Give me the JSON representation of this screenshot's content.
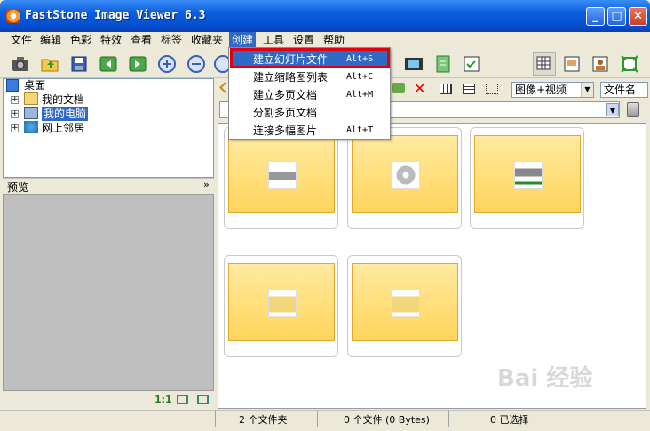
{
  "window": {
    "title": "FastStone Image Viewer 6.3",
    "minimize": "_",
    "maximize": "□",
    "close": "✕"
  },
  "menu": [
    "文件",
    "编辑",
    "色彩",
    "特效",
    "查看",
    "标签",
    "收藏夹",
    "创建",
    "工具",
    "设置",
    "帮助"
  ],
  "dropdown": [
    {
      "label": "建立幻灯片文件",
      "shortcut": "Alt+S"
    },
    {
      "label": "建立缩略图列表",
      "shortcut": "Alt+C"
    },
    {
      "label": "建立多页文档",
      "shortcut": "Alt+M"
    },
    {
      "label": "分割多页文档",
      "shortcut": ""
    },
    {
      "label": "连接多幅图片",
      "shortcut": "Alt+T"
    }
  ],
  "tree": {
    "root": "桌面",
    "items": [
      "我的文档",
      "我的电脑",
      "网上邻居"
    ]
  },
  "preview": {
    "title": "预览",
    "collapse": "»",
    "zoom": "1:1"
  },
  "browser": {
    "filter": "图像+视频",
    "sort": "文件名",
    "thumbnails": [
      "hard-drive",
      "cd-drive",
      "network-drive",
      "folder",
      "folder"
    ]
  },
  "status": {
    "folders": "2 个文件夹",
    "files": "0 个文件 (0 Bytes)",
    "selected": "0 已选择"
  },
  "watermark": "Bai 经验",
  "colors": {
    "titlebar": "#0a5fde",
    "highlight": "#316ac5",
    "callout": "#e00010",
    "thumb": "#ffd45c"
  }
}
